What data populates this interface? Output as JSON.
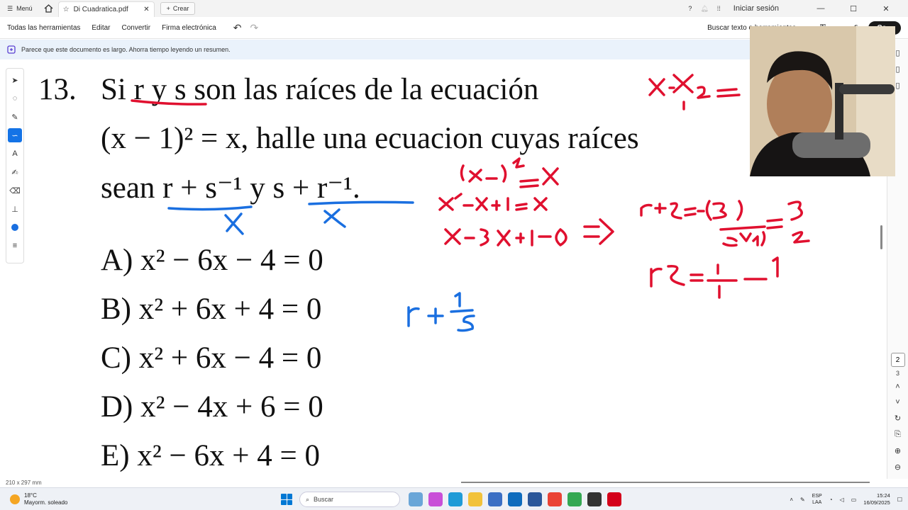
{
  "titlebar": {
    "menu_label": "Menú",
    "tab_title": "Di Cuadratica.pdf",
    "new_tab_label": "Crear",
    "signin_label": "Iniciar sesión"
  },
  "toolbar": {
    "items": [
      "Todas las herramientas",
      "Editar",
      "Convertir",
      "Firma electrónica"
    ],
    "search_label": "Buscar texto o herramientas",
    "share_label": "Co..."
  },
  "notice": {
    "text": "Parece que este documento es largo. Ahorra tiempo leyendo un resumen."
  },
  "document": {
    "problem_number": "13.",
    "line1": "Si r y s son las raíces de la ecuación",
    "line2": "(x − 1)² = x, halle una ecuacion cuyas raíces",
    "line3": "sean r + s⁻¹ y s + r⁻¹.",
    "options": [
      "A) x² − 6x − 4 = 0",
      "B) x² + 6x + 4 = 0",
      "C) x² + 6x − 4 = 0",
      "D) x² − 4x + 6 = 0",
      "E) x² − 6x + 4 = 0"
    ],
    "page_size": "210 x 297 mm"
  },
  "annotations": {
    "red_color": "#e0102f",
    "blue_color": "#1a6fe0"
  },
  "right_rail": {
    "current_page": "2",
    "next_page": "3"
  },
  "taskbar": {
    "temperature": "18°C",
    "weather": "Mayorm. soleado",
    "search_placeholder": "Buscar",
    "lang_line1": "ESP",
    "lang_line2": "LAA",
    "time": "15:24",
    "date": "16/09/2025"
  }
}
